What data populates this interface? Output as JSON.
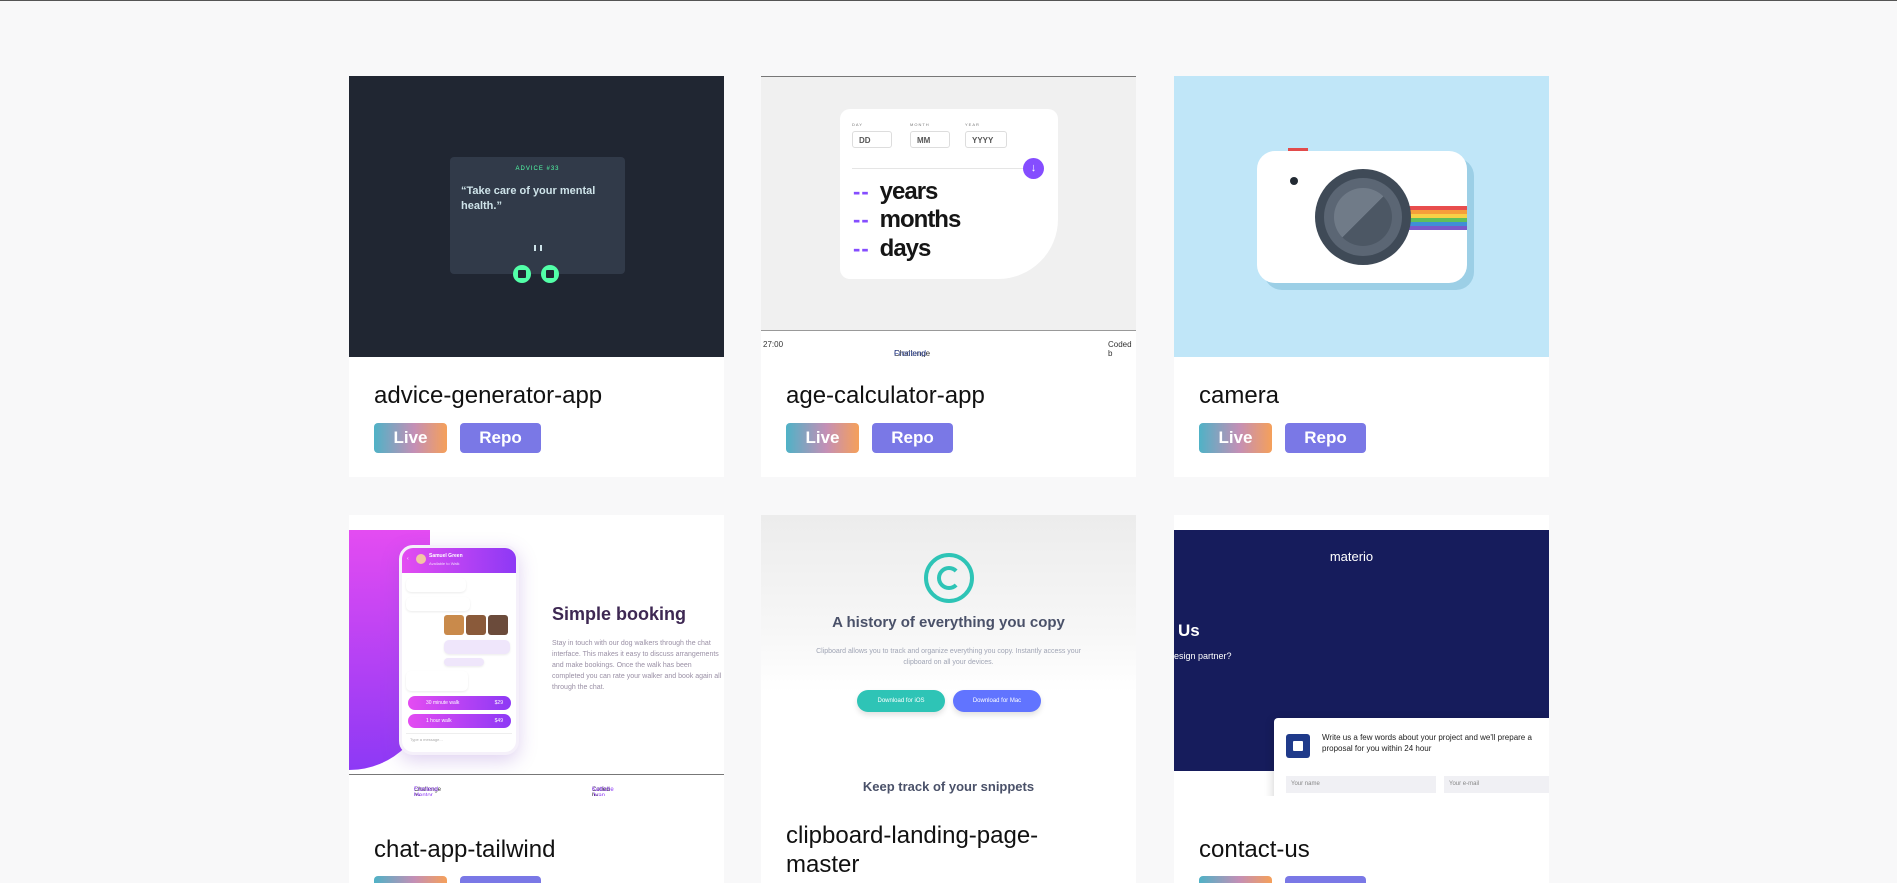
{
  "cards": [
    {
      "title": "advice-generator-app",
      "live_label": "Live",
      "repo_label": "Repo",
      "preview": {
        "label": "ADVICE #33",
        "quote": "“Take care of your mental health.”"
      }
    },
    {
      "title": "age-calculator-app",
      "live_label": "Live",
      "repo_label": "Repo",
      "preview": {
        "day_label": "DAY",
        "month_label": "MONTH",
        "year_label": "YEAR",
        "day_placeholder": "DD",
        "month_placeholder": "MM",
        "year_placeholder": "YYYY",
        "dash": "--",
        "years": "years",
        "months": "months",
        "days": "days",
        "footer_left": "27:00",
        "footer_challenge": "Challenge by",
        "footer_link": "Frontend Mentor",
        "footer_right": "Coded b"
      }
    },
    {
      "title": "camera",
      "live_label": "Live",
      "repo_label": "Repo"
    },
    {
      "title": "chat-app-tailwind",
      "preview": {
        "contact_name": "Samuel Green",
        "contact_status": "Available to Walk",
        "heading": "Simple booking",
        "text": "Stay in touch with our dog walkers through the chat interface. This makes it easy to discuss arrangements and make bookings. Once the walk has been completed you can rate your walker and book again all through the chat.",
        "pay_30": "30 minute walk",
        "price_30": "$29",
        "pay_60": "1 hour walk",
        "price_60": "$49",
        "input_placeholder": "Type a message...",
        "footer_challenge": "Challenge by",
        "footer_link": "Frontend Mentor",
        "footer_coded": "Coded by",
        "footer_author": "Kattiche Juan"
      }
    },
    {
      "title": "clipboard-landing-page-master",
      "preview": {
        "heading": "A history of everything you copy",
        "text": "Clipboard allows you to track and organize everything you copy. Instantly access your clipboard on all your devices.",
        "ios_button": "Download for iOS",
        "mac_button": "Download for Mac",
        "heading2": "Keep track of your snippets"
      }
    },
    {
      "title": "contact-us",
      "preview": {
        "logo": "materio",
        "heading": "Us",
        "subtext": "esign partner?",
        "form_text": "Write us a few words about your project and we'll prepare a proposal for you within 24 hour",
        "name_placeholder": "Your name",
        "email_placeholder": "Your e-mail"
      }
    }
  ],
  "colors": {
    "page_bg": "#f8f8f9",
    "repo_button": "#7a78e6",
    "live_gradient": [
      "#4fb2c6",
      "#c48fb6",
      "#f5a05a"
    ]
  }
}
